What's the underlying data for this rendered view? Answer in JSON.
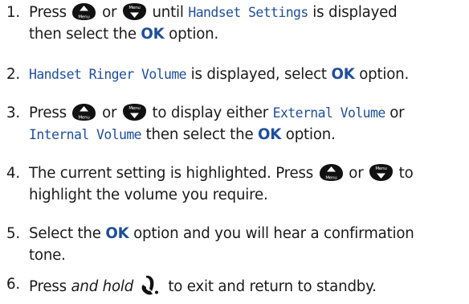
{
  "icons": {
    "up": "up-arrow-menu-button-icon",
    "down": "down-arrow-menu-button-icon",
    "end": "end-call-icon",
    "button_color": "#111111",
    "button_label": "Menu"
  },
  "steps": [
    {
      "number": "1.",
      "t1": "Press",
      "or": "or",
      "t2": "until",
      "lcd": "Handset Settings",
      "t3": "is displayed",
      "t4": "then select the",
      "ok": "OK",
      "t5": "option."
    },
    {
      "number": "2.",
      "lcd": "Handset Ringer Volume",
      "t1": "is displayed, select",
      "ok": "OK",
      "t2": "option."
    },
    {
      "number": "3.",
      "t1": "Press",
      "or": "or",
      "t2": "to display either",
      "lcd1": "External Volume",
      "or2": "or",
      "lcd2": "Internal Volume",
      "t3": "then select the",
      "ok": "OK",
      "t4": "option."
    },
    {
      "number": "4.",
      "t1": "The current setting is highlighted. Press",
      "or": "or",
      "t2": "to",
      "t3": "highlight the volume you require."
    },
    {
      "number": "5.",
      "t1": "Select the",
      "ok": "OK",
      "t2": "option and you will hear a confirmation",
      "t3": "tone."
    },
    {
      "number": "6.",
      "t1": "Press",
      "em": "and hold",
      "t2": "to exit and return to standby."
    }
  ]
}
